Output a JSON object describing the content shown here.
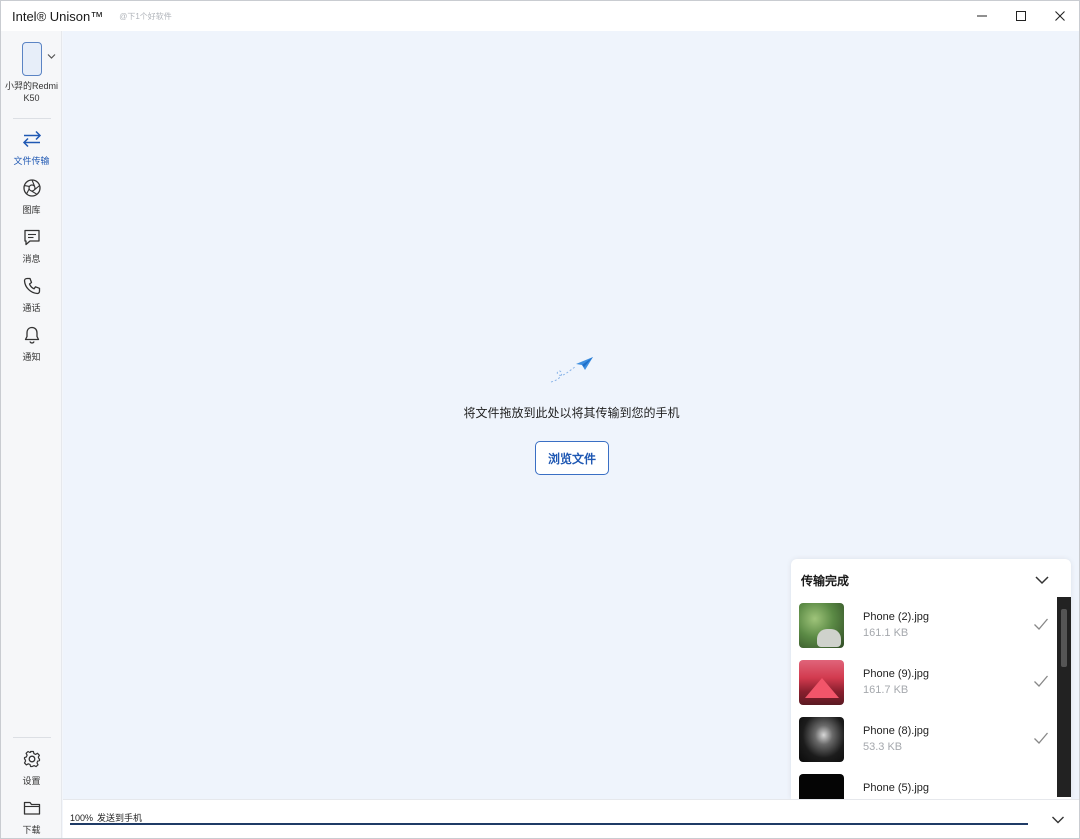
{
  "window": {
    "title": "Intel® Unison™",
    "watermark": "@下1个好软件",
    "controls": [
      "minimize",
      "maximize",
      "close"
    ]
  },
  "sidebar": {
    "device": {
      "name_line1": "小羿的Redmi",
      "name_line2": "K50"
    },
    "items": [
      {
        "label": "文件传输",
        "icon": "swap-arrows-icon",
        "active": true
      },
      {
        "label": "图库",
        "icon": "aperture-icon",
        "active": false
      },
      {
        "label": "消息",
        "icon": "chat-icon",
        "active": false
      },
      {
        "label": "通话",
        "icon": "phone-icon",
        "active": false
      },
      {
        "label": "通知",
        "icon": "bell-icon",
        "active": false
      }
    ],
    "bottom_items": [
      {
        "label": "设置",
        "icon": "gear-icon"
      },
      {
        "label": "下载",
        "icon": "folder-icon"
      }
    ]
  },
  "main": {
    "drop_text": "将文件拖放到此处以将其传输到您的手机",
    "browse_label": "浏览文件"
  },
  "transfer_panel": {
    "title": "传输完成",
    "files": [
      {
        "name": "Phone (2).jpg",
        "size": "161.1 KB",
        "status": "done"
      },
      {
        "name": "Phone (9).jpg",
        "size": "161.7 KB",
        "status": "done"
      },
      {
        "name": "Phone (8).jpg",
        "size": "53.3 KB",
        "status": "done"
      },
      {
        "name": "Phone (5).jpg",
        "size": "",
        "status": "done"
      }
    ]
  },
  "status": {
    "percent": "100%",
    "text": "发送到手机",
    "progress": 1.0
  },
  "colors": {
    "accent": "#1f58b3",
    "main_bg": "#eff4fc",
    "progress": "#1f3b66"
  }
}
